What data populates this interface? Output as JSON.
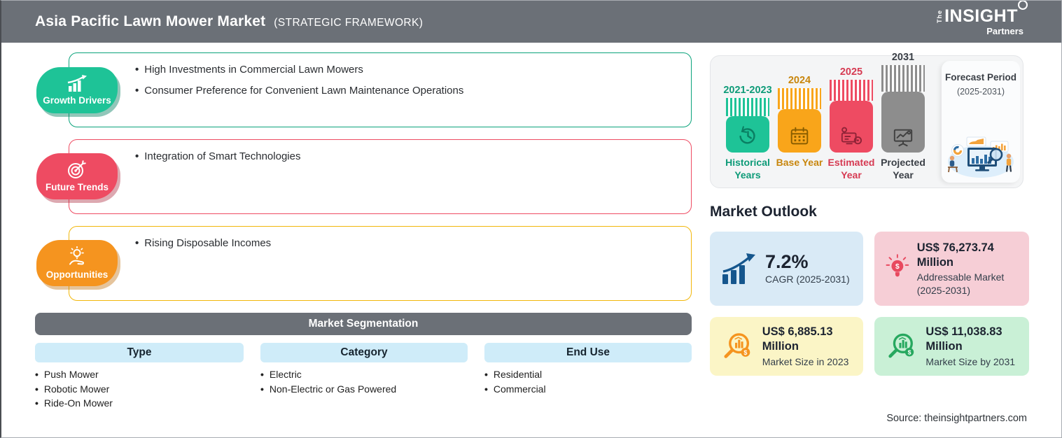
{
  "header": {
    "title": "Asia Pacific Lawn Mower Market",
    "subtitle": "(STRATEGIC FRAMEWORK)",
    "logo_the": "The",
    "logo_insight": "INSIGHT",
    "logo_partners": "Partners"
  },
  "framework": {
    "sections": [
      {
        "label": "Growth Drivers",
        "icon": "growth-chart-icon",
        "color": "#1ec397",
        "bullets": [
          "High Investments in Commercial Lawn Mowers",
          "Consumer Preference for Convenient Lawn Maintenance Operations"
        ]
      },
      {
        "label": "Future Trends",
        "icon": "target-dart-icon",
        "color": "#ee4b62",
        "bullets": [
          "Integration of Smart Technologies"
        ]
      },
      {
        "label": "Opportunities",
        "icon": "hand-lightbulb-icon",
        "color": "#f5941f",
        "bullets": [
          "Rising Disposable Incomes"
        ]
      }
    ]
  },
  "segmentation": {
    "title": "Market Segmentation",
    "columns": [
      {
        "label": "Type",
        "items": [
          "Push Mower",
          "Robotic Mower",
          "Ride-On Mower"
        ]
      },
      {
        "label": "Category",
        "items": [
          "Electric",
          "Non-Electric or Gas Powered"
        ]
      },
      {
        "label": "End Use",
        "items": [
          "Residential",
          "Commercial"
        ]
      }
    ]
  },
  "timeline": {
    "bars": [
      {
        "year": "2021-2023",
        "label": "Historical Years",
        "icon": "history-clock-icon",
        "color": "#1ec397"
      },
      {
        "year": "2024",
        "label": "Base Year",
        "icon": "calendar-icon",
        "color": "#f9a51a"
      },
      {
        "year": "2025",
        "label": "Estimated Year",
        "icon": "estimate-calc-icon",
        "color": "#ee4b62"
      },
      {
        "year": "2031",
        "label": "Projected Year",
        "icon": "projection-screen-icon",
        "color": "#8d8d8d"
      }
    ],
    "forecast_title": "Forecast Period",
    "forecast_range": "(2025-2031)"
  },
  "outlook": {
    "title": "Market Outlook",
    "cards": [
      {
        "value": "7.2%",
        "label": "CAGR (2025-2031)",
        "icon": "bar-chart-growth-icon",
        "bg": "#d9eaf6"
      },
      {
        "value": "US$ 76,273.74 Million",
        "label": "Addressable Market (2025-2031)",
        "icon": "lightbulb-dollar-icon",
        "bg": "#f6ced6"
      },
      {
        "value": "US$ 6,885.13 Million",
        "label": "Market Size in 2023",
        "icon": "magnifier-chart-orange-icon",
        "bg": "#fbf5c6"
      },
      {
        "value": "US$ 11,038.83 Million",
        "label": "Market Size by 2031",
        "icon": "magnifier-chart-green-icon",
        "bg": "#c9f0d6"
      }
    ]
  },
  "source": "Source: theinsightpartners.com",
  "colors": {
    "header_bar": "#6b7077",
    "green": "#1ec397",
    "green_dark": "#0e9b78",
    "gold": "#f9a51a",
    "gold_dark": "#c8860d",
    "red": "#ee4b62",
    "red_dark": "#d63a52",
    "orange_badge": "#f5941f",
    "gray_bar": "#8d8d8d",
    "segment_header_bg": "#cfecf9",
    "navy": "#15568d"
  }
}
